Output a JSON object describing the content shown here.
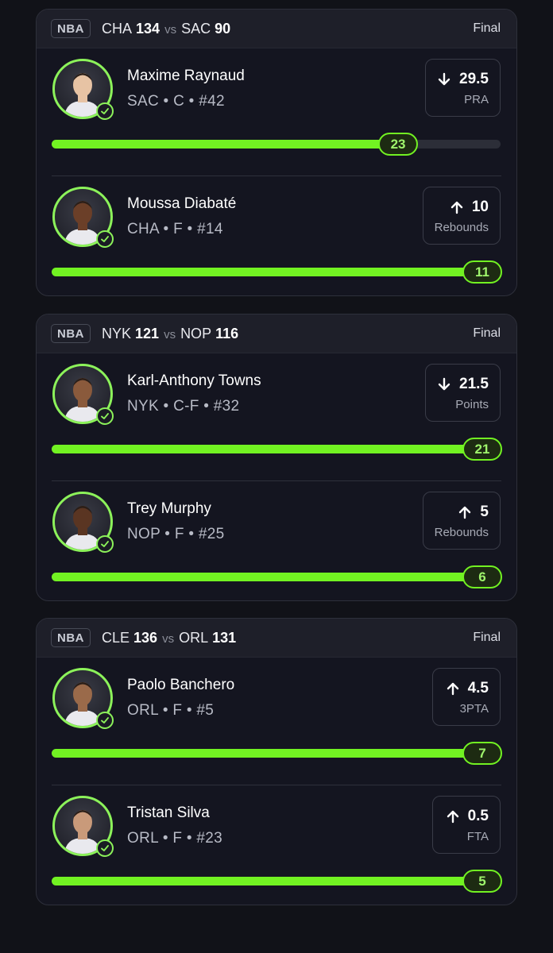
{
  "games": [
    {
      "league": "NBA",
      "away_team": "CHA",
      "away_score": "134",
      "vs": "vs",
      "home_team": "SAC",
      "home_score": "90",
      "status": "Final",
      "players": [
        {
          "name": "Maxime Raynaud",
          "meta": "SAC • C • #42",
          "line": "29.5",
          "direction": "down",
          "stat": "PRA",
          "actual": "23",
          "progress": 0.77
        },
        {
          "name": "Moussa Diabaté",
          "meta": "CHA • F • #14",
          "line": "10",
          "direction": "up",
          "stat": "Rebounds",
          "actual": "11",
          "progress": 1.0
        }
      ]
    },
    {
      "league": "NBA",
      "away_team": "NYK",
      "away_score": "121",
      "vs": "vs",
      "home_team": "NOP",
      "home_score": "116",
      "status": "Final",
      "players": [
        {
          "name": "Karl-Anthony Towns",
          "meta": "NYK • C-F • #32",
          "line": "21.5",
          "direction": "down",
          "stat": "Points",
          "actual": "21",
          "progress": 1.0
        },
        {
          "name": "Trey Murphy",
          "meta": "NOP • F • #25",
          "line": "5",
          "direction": "up",
          "stat": "Rebounds",
          "actual": "6",
          "progress": 1.0
        }
      ]
    },
    {
      "league": "NBA",
      "away_team": "CLE",
      "away_score": "136",
      "vs": "vs",
      "home_team": "ORL",
      "home_score": "131",
      "status": "Final",
      "players": [
        {
          "name": "Paolo Banchero",
          "meta": "ORL • F • #5",
          "line": "4.5",
          "direction": "up",
          "stat": "3PTA",
          "actual": "7",
          "progress": 1.0
        },
        {
          "name": "Tristan Silva",
          "meta": "ORL • F • #23",
          "line": "0.5",
          "direction": "up",
          "stat": "FTA",
          "actual": "5",
          "progress": 1.0
        }
      ]
    }
  ],
  "colors": {
    "accent": "#72f222",
    "ring": "#8cf25a",
    "background": "#111218",
    "card": "#141520"
  },
  "icons": {
    "up": "arrow-up-icon",
    "down": "arrow-down-icon",
    "check": "check-circle-icon",
    "avatar": "player-headshot"
  }
}
